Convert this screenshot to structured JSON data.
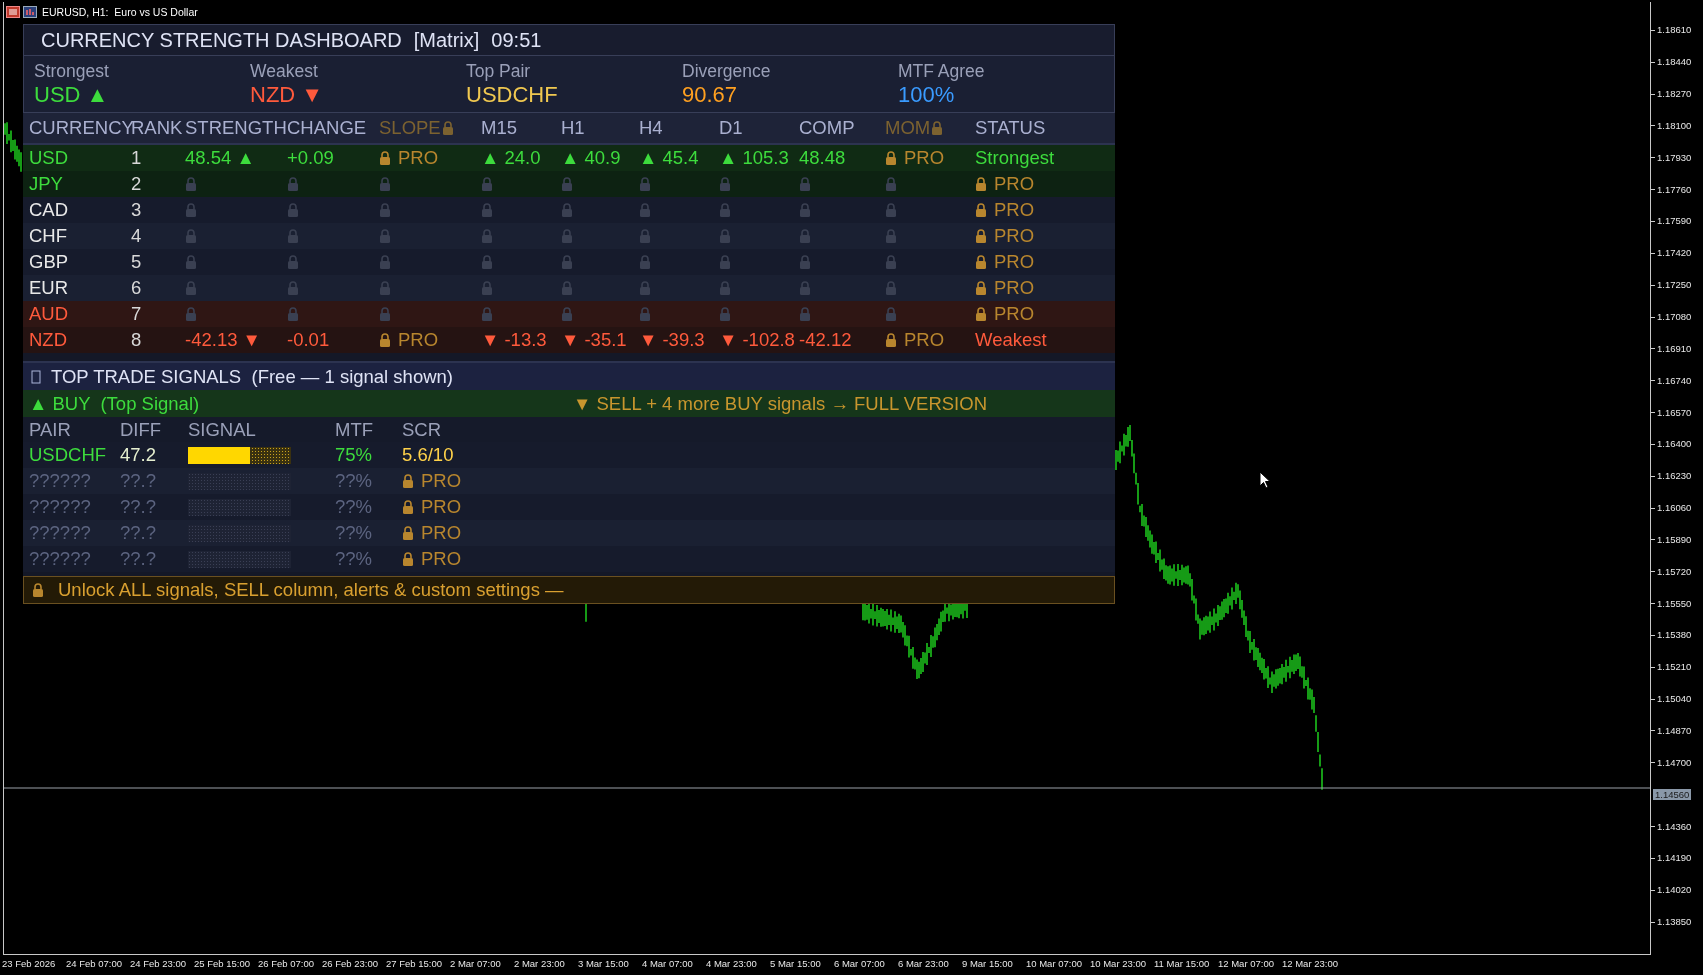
{
  "window": {
    "title": "EURUSD, H1:  Euro vs US Dollar"
  },
  "dashboard": {
    "title": "CURRENCY STRENGTH DASHBOARD",
    "mode": "[Matrix]",
    "time": "09:51",
    "summary": [
      {
        "label": "Strongest",
        "value": "USD ▲",
        "color": "#3ddc3d"
      },
      {
        "label": "Weakest",
        "value": "NZD ▼",
        "color": "#ff5a3c"
      },
      {
        "label": "Top Pair",
        "value": "USDCHF",
        "color": "#f0c850"
      },
      {
        "label": "Divergence",
        "value": "90.67",
        "color": "#ffa020"
      },
      {
        "label": "MTF Agree",
        "value": "100%",
        "color": "#3a9bff"
      }
    ]
  },
  "matrix": {
    "columns": [
      {
        "label": "CURRENCY",
        "locked": false
      },
      {
        "label": "RANK",
        "locked": false
      },
      {
        "label": "STRENGTH",
        "locked": false
      },
      {
        "label": "CHANGE",
        "locked": false
      },
      {
        "label": "SLOPE",
        "locked": true
      },
      {
        "label": "M15",
        "locked": false
      },
      {
        "label": "H1",
        "locked": false
      },
      {
        "label": "H4",
        "locked": false
      },
      {
        "label": "D1",
        "locked": false
      },
      {
        "label": "COMP",
        "locked": false
      },
      {
        "label": "MOM",
        "locked": true
      },
      {
        "label": "STATUS",
        "locked": false
      }
    ],
    "rows": [
      {
        "kind": "full",
        "highlighted": true,
        "color": "#3ddc3d",
        "currency": "USD",
        "rank": "1",
        "cells": [
          {
            "text": "48.54 ▲",
            "locked": false
          },
          {
            "text": "+0.09",
            "locked": false
          },
          {
            "text": "PRO",
            "locked": true
          },
          {
            "text": "▲ 24.0",
            "locked": false
          },
          {
            "text": "▲ 40.9",
            "locked": false
          },
          {
            "text": "▲ 45.4",
            "locked": false
          },
          {
            "text": "▲ 105.3",
            "locked": false
          },
          {
            "text": "48.48",
            "locked": false
          },
          {
            "text": "PRO",
            "locked": true
          },
          {
            "text": "Strongest",
            "locked": false
          }
        ]
      },
      {
        "kind": "locked",
        "highlighted": true,
        "color": "#3ddc3d",
        "currency": "JPY",
        "rank": "2",
        "status": "PRO"
      },
      {
        "kind": "locked",
        "highlighted": false,
        "color": "#e8e8e8",
        "currency": "CAD",
        "rank": "3",
        "status": "PRO"
      },
      {
        "kind": "locked",
        "highlighted": false,
        "color": "#e8e8e8",
        "currency": "CHF",
        "rank": "4",
        "status": "PRO"
      },
      {
        "kind": "locked",
        "highlighted": false,
        "color": "#e8e8e8",
        "currency": "GBP",
        "rank": "5",
        "status": "PRO"
      },
      {
        "kind": "locked",
        "highlighted": false,
        "color": "#e8e8e8",
        "currency": "EUR",
        "rank": "6",
        "status": "PRO"
      },
      {
        "kind": "locked",
        "highlighted": true,
        "color": "#ff5a3c",
        "currency": "AUD",
        "rank": "7",
        "status": "PRO"
      },
      {
        "kind": "full",
        "highlighted": true,
        "color": "#ff5a3c",
        "currency": "NZD",
        "rank": "8",
        "cells": [
          {
            "text": "-42.13 ▼",
            "locked": false
          },
          {
            "text": "-0.01",
            "locked": false
          },
          {
            "text": "PRO",
            "locked": true
          },
          {
            "text": "▼ -13.3",
            "locked": false
          },
          {
            "text": "▼ -35.1",
            "locked": false
          },
          {
            "text": "▼ -39.3",
            "locked": false
          },
          {
            "text": "▼ -102.8",
            "locked": false
          },
          {
            "text": "-42.12",
            "locked": false
          },
          {
            "text": "PRO",
            "locked": true
          },
          {
            "text": "Weakest",
            "locked": false
          }
        ]
      }
    ]
  },
  "signals": {
    "title": "TOP TRADE SIGNALS  (Free — 1 signal shown)",
    "buy": "▲ BUY  (Top Signal)",
    "upsell": "▼ SELL + 4 more BUY signals → FULL VERSION",
    "columns": [
      "PAIR",
      "DIFF",
      "SIGNAL",
      "MTF",
      "SCR"
    ],
    "rows": [
      {
        "kind": "full",
        "pair": "USDCHF",
        "diff": "47.2",
        "level": 0.6,
        "mtf": "75%",
        "score": "5.6/10"
      },
      {
        "kind": "locked",
        "pair": "??????",
        "diff": "??.?",
        "mtf": "??%",
        "score": "PRO"
      },
      {
        "kind": "locked",
        "pair": "??????",
        "diff": "??.?",
        "mtf": "??%",
        "score": "PRO"
      },
      {
        "kind": "locked",
        "pair": "??????",
        "diff": "??.?",
        "mtf": "??%",
        "score": "PRO"
      },
      {
        "kind": "locked",
        "pair": "??????",
        "diff": "??.?",
        "mtf": "??%",
        "score": "PRO"
      }
    ]
  },
  "footer": {
    "text": "Unlock ALL signals, SELL column, alerts & custom settings —"
  },
  "price_axis": {
    "labels": [
      {
        "kind": "tick",
        "text": "1.18610"
      },
      {
        "kind": "tick",
        "text": "1.18440"
      },
      {
        "kind": "tick",
        "text": "1.18270"
      },
      {
        "kind": "tick",
        "text": "1.18100"
      },
      {
        "kind": "tick",
        "text": "1.17930"
      },
      {
        "kind": "tick",
        "text": "1.17760"
      },
      {
        "kind": "tick",
        "text": "1.17590"
      },
      {
        "kind": "tick",
        "text": "1.17420"
      },
      {
        "kind": "tick",
        "text": "1.17250"
      },
      {
        "kind": "tick",
        "text": "1.17080"
      },
      {
        "kind": "tick",
        "text": "1.16910"
      },
      {
        "kind": "tick",
        "text": "1.16740"
      },
      {
        "kind": "tick",
        "text": "1.16570"
      },
      {
        "kind": "tick",
        "text": "1.16400"
      },
      {
        "kind": "tick",
        "text": "1.16230"
      },
      {
        "kind": "tick",
        "text": "1.16060"
      },
      {
        "kind": "tick",
        "text": "1.15890"
      },
      {
        "kind": "tick",
        "text": "1.15720"
      },
      {
        "kind": "tick",
        "text": "1.15550"
      },
      {
        "kind": "tick",
        "text": "1.15380"
      },
      {
        "kind": "tick",
        "text": "1.15210"
      },
      {
        "kind": "tick",
        "text": "1.15040"
      },
      {
        "kind": "tick",
        "text": "1.14870"
      },
      {
        "kind": "tick",
        "text": "1.14700"
      },
      {
        "kind": "current",
        "text": "1.14560"
      },
      {
        "kind": "tick",
        "text": "1.14360"
      },
      {
        "kind": "tick",
        "text": "1.14190"
      },
      {
        "kind": "tick",
        "text": "1.14020"
      },
      {
        "kind": "tick",
        "text": "1.13850"
      }
    ]
  },
  "time_axis": {
    "labels": [
      "23 Feb 2026",
      "24 Feb 07:00",
      "24 Feb 23:00",
      "25 Feb 15:00",
      "26 Feb 07:00",
      "26 Feb 23:00",
      "27 Feb 15:00",
      "2 Mar 07:00",
      "2 Mar 23:00",
      "3 Mar 15:00",
      "4 Mar 07:00",
      "4 Mar 23:00",
      "5 Mar 15:00",
      "6 Mar 07:00",
      "6 Mar 23:00",
      "9 Mar 15:00",
      "10 Mar 07:00",
      "10 Mar 23:00",
      "11 Mar 15:00",
      "12 Mar 07:00",
      "12 Mar 23:00"
    ]
  }
}
